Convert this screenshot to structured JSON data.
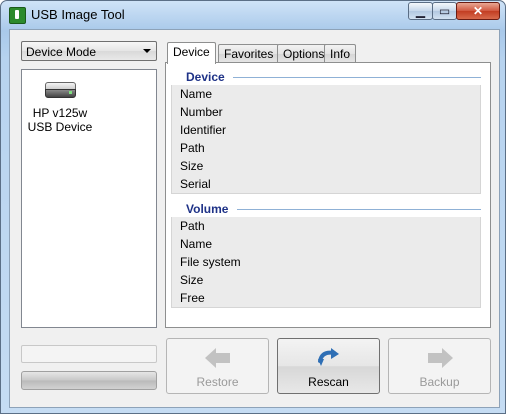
{
  "window": {
    "title": "USB Image Tool",
    "controls": {
      "minimize": "▁",
      "maximize": "▭",
      "close": "✕"
    }
  },
  "mode_select": {
    "value": "Device Mode"
  },
  "device_list": [
    {
      "label_line1": "HP v125w",
      "label_line2": "USB Device",
      "icon": "usb-drive-icon"
    }
  ],
  "tabs": [
    {
      "label": "Device",
      "active": true
    },
    {
      "label": "Favorites",
      "active": false
    },
    {
      "label": "Options",
      "active": false
    },
    {
      "label": "Info",
      "active": false
    }
  ],
  "device_group": {
    "title": "Device",
    "fields": [
      "Name",
      "Number",
      "Identifier",
      "Path",
      "Size",
      "Serial"
    ]
  },
  "volume_group": {
    "title": "Volume",
    "fields": [
      "Path",
      "Name",
      "File system",
      "Size",
      "Free"
    ]
  },
  "buttons": {
    "restore": {
      "label": "Restore",
      "enabled": false,
      "icon": "arrow-left-icon"
    },
    "rescan": {
      "label": "Rescan",
      "enabled": true,
      "icon": "rescan-arrow-icon"
    },
    "backup": {
      "label": "Backup",
      "enabled": false,
      "icon": "arrow-right-icon"
    }
  },
  "colors": {
    "group_header_text": "#1e3287",
    "tab_panel_background": "#ffffff",
    "group_body_background": "#ebebeb"
  }
}
